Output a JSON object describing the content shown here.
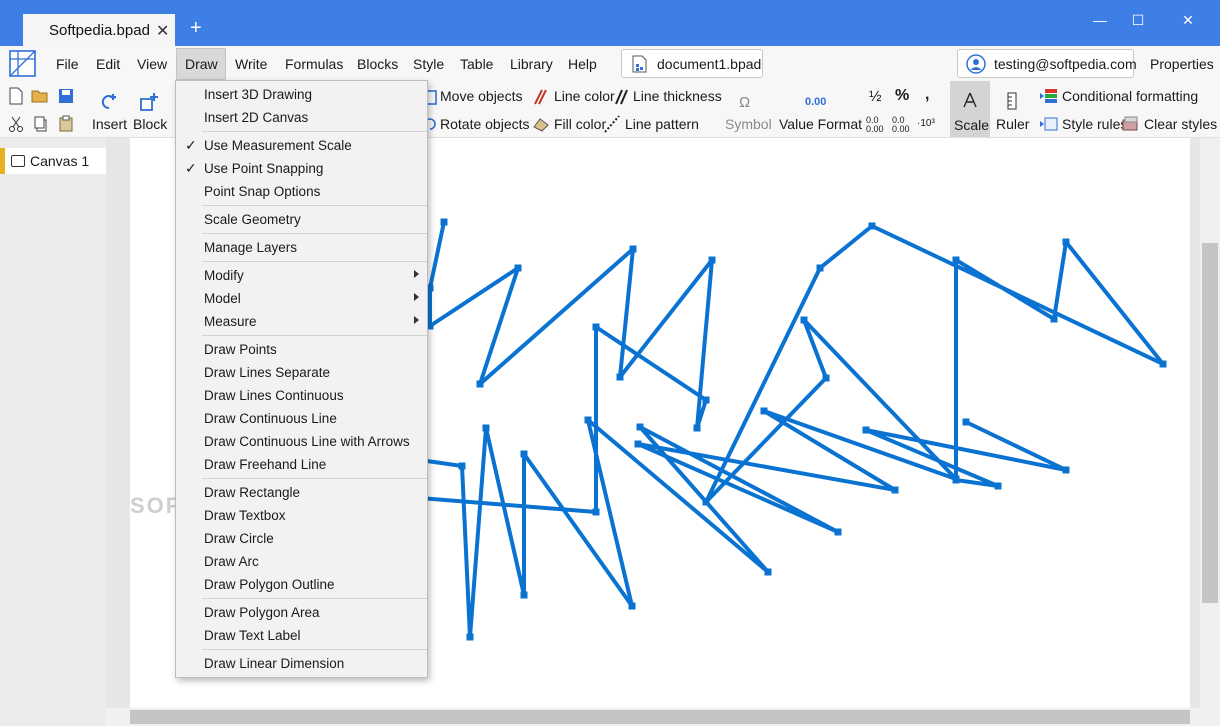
{
  "window": {
    "tab_title": "Softpedia.bpad",
    "new_tab": "+",
    "minimize": "—",
    "maximize": "☐",
    "close": "✕"
  },
  "menubar": {
    "items": [
      "File",
      "Edit",
      "View",
      "Draw",
      "Write",
      "Formulas",
      "Blocks",
      "Style",
      "Table",
      "Library",
      "Help"
    ],
    "active": "Draw",
    "document": "document1.bpad",
    "user": "testing@softpedia.com",
    "properties": "Properties"
  },
  "ribbon": {
    "insert": "Insert",
    "block": "Block",
    "move_objects": "Move objects",
    "rotate_objects": "Rotate objects",
    "line_color": "Line color",
    "fill_color": "Fill color",
    "line_thickness": "Line thickness",
    "line_pattern": "Line pattern",
    "symbol": "Symbol",
    "value_format": "Value Format",
    "value_format_sample": "0.00",
    "scale": "Scale",
    "ruler": "Ruler",
    "conditional_formatting": "Conditional formatting",
    "style_rules": "Style rules",
    "clear_styles": "Clear styles",
    "half": "½",
    "percent": "%",
    "comma": ",",
    "dec_inc": "0.0 0.00",
    "dec_dec": "0.0 0.00",
    "sci": "·10³"
  },
  "left_panel": {
    "canvas": "Canvas 1"
  },
  "watermark": "SOFTPEDIA",
  "draw_menu": {
    "items": [
      {
        "label": "Insert 3D Drawing"
      },
      {
        "label": "Insert 2D Canvas"
      },
      {
        "label": "Use Measurement Scale",
        "checked": "✓"
      },
      {
        "label": "Use Point Snapping",
        "checked": "✓"
      },
      {
        "label": "Point Snap Options"
      },
      {
        "label": "Scale Geometry"
      },
      {
        "label": "Manage Layers"
      },
      {
        "label": "Modify"
      },
      {
        "label": "Model"
      },
      {
        "label": "Measure"
      },
      {
        "label": "Draw Points"
      },
      {
        "label": "Draw Lines Separate"
      },
      {
        "label": "Draw Lines Continuous"
      },
      {
        "label": "Draw Continuous Line"
      },
      {
        "label": "Draw Continuous Line with Arrows"
      },
      {
        "label": "Draw Freehand Line"
      },
      {
        "label": "Draw Rectangle"
      },
      {
        "label": "Draw Textbox"
      },
      {
        "label": "Draw Circle"
      },
      {
        "label": "Draw Arc"
      },
      {
        "label": "Draw Polygon Outline"
      },
      {
        "label": "Draw Polygon Area"
      },
      {
        "label": "Draw Text Label"
      },
      {
        "label": "Draw Linear Dimension"
      }
    ]
  },
  "colors": {
    "titlebar": "#3e7fe6",
    "line": "#0a73d2",
    "accent": "#e6b020"
  }
}
